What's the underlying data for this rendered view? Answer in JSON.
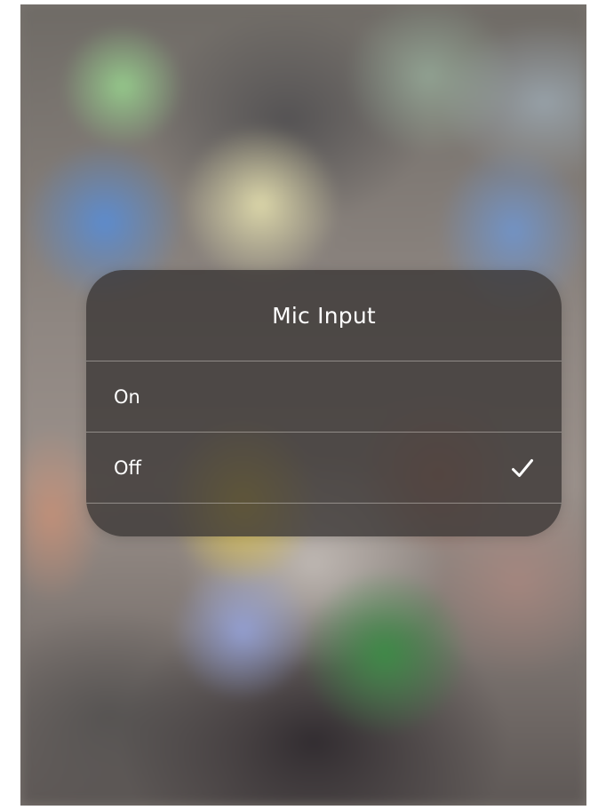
{
  "dialog": {
    "title": "Mic Input",
    "options": [
      {
        "label": "On",
        "selected": false
      },
      {
        "label": "Off",
        "selected": true
      }
    ],
    "selected_icon": "checkmark-icon"
  },
  "colors": {
    "dialog_background": "#3a3634",
    "text": "#ffffff",
    "separator": "#c8c3be"
  }
}
